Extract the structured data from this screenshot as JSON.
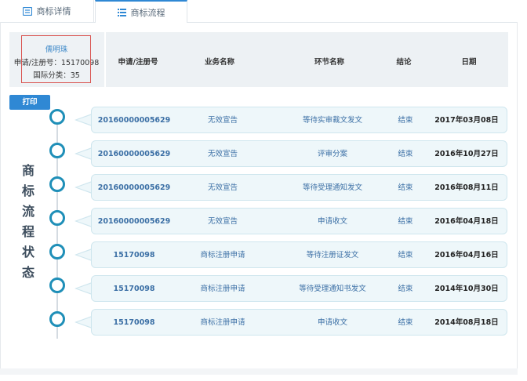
{
  "tabs": [
    {
      "label": "商标详情",
      "icon": "document-icon",
      "active": false
    },
    {
      "label": "商标流程",
      "icon": "list-icon",
      "active": true
    }
  ],
  "app_info": {
    "owner": "儒明珠",
    "app_no_line": "申请/注册号：15170098",
    "class_line": "国际分类：35"
  },
  "table_headers": {
    "app_no": "申请/注册号",
    "business": "业务名称",
    "step": "环节名称",
    "result": "结论",
    "date": "日期"
  },
  "print_button": "打印",
  "vertical_title": [
    "商",
    "标",
    "流",
    "程",
    "状",
    "态"
  ],
  "rows": [
    {
      "app_no": "20160000005629",
      "business": "无效宣告",
      "step": "等待实审裁文发文",
      "result": "结束",
      "date": "2017年03月08日"
    },
    {
      "app_no": "20160000005629",
      "business": "无效宣告",
      "step": "评审分案",
      "result": "结束",
      "date": "2016年10月27日"
    },
    {
      "app_no": "20160000005629",
      "business": "无效宣告",
      "step": "等待受理通知发文",
      "result": "结束",
      "date": "2016年08月11日"
    },
    {
      "app_no": "20160000005629",
      "business": "无效宣告",
      "step": "申请收文",
      "result": "结束",
      "date": "2016年04月18日"
    },
    {
      "app_no": "15170098",
      "business": "商标注册申请",
      "step": "等待注册证发文",
      "result": "结束",
      "date": "2016年04月16日"
    },
    {
      "app_no": "15170098",
      "business": "商标注册申请",
      "step": "等待受理通知书发文",
      "result": "结束",
      "date": "2014年10月30日"
    },
    {
      "app_no": "15170098",
      "business": "商标注册申请",
      "step": "申请收文",
      "result": "结束",
      "date": "2014年08月18日"
    }
  ],
  "colors": {
    "accent": "#2f88d4",
    "node_ring": "#1f8fb8",
    "highlight_box": "#d9534f",
    "row_bg": "#eef7fa"
  }
}
